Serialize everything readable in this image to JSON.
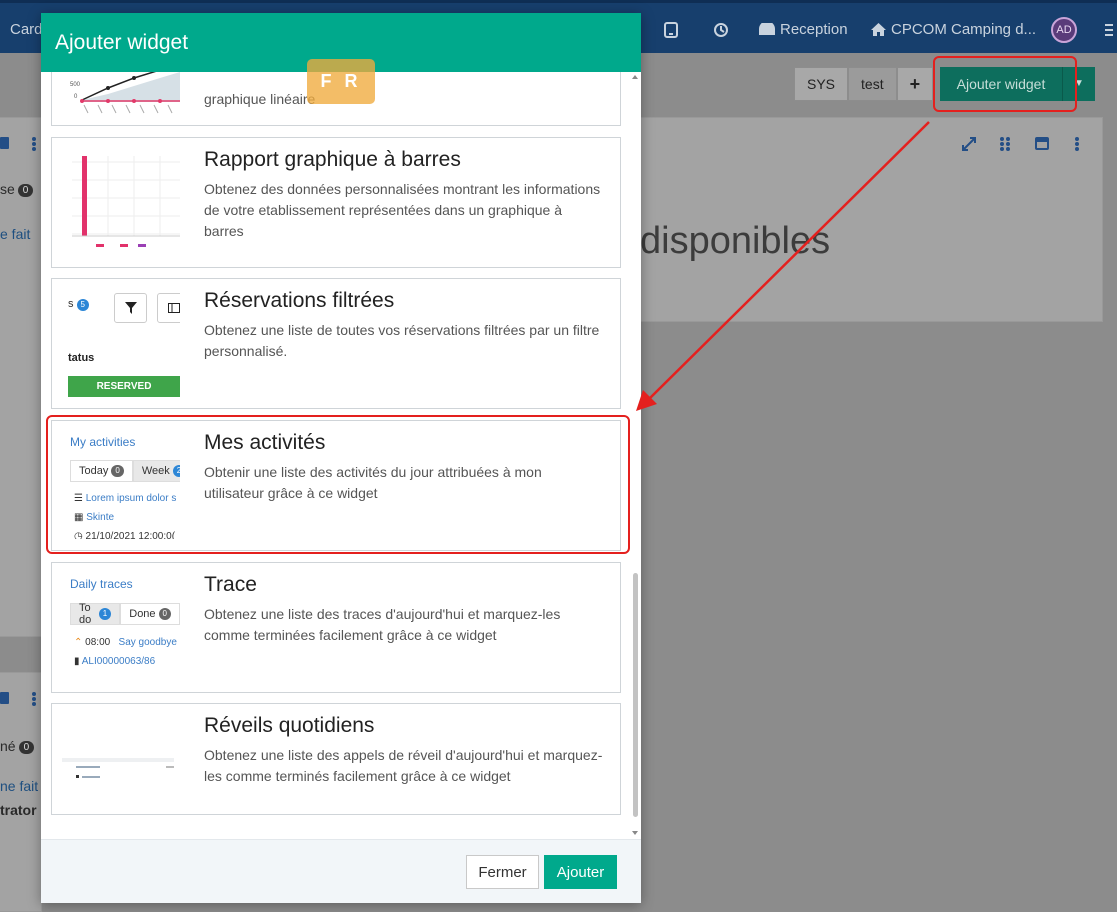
{
  "topbar": {
    "card_label": "Card",
    "reception_label": "Reception",
    "camping_label": "CPCOM Camping d...",
    "avatar_initials": "AD"
  },
  "background": {
    "seg_sys": "SYS",
    "seg_test": "test",
    "seg_plus": "+",
    "add_widget": "Ajouter widget",
    "big_text": "disponibles",
    "left_texts": [
      "se",
      "e fait",
      "né",
      "ne fait",
      "trator"
    ],
    "left_badges": [
      "0",
      "0"
    ]
  },
  "modal": {
    "title": "Ajouter widget",
    "lang_tag": "F R",
    "close_label": "Fermer",
    "add_label": "Ajouter"
  },
  "widgets": [
    {
      "title": "",
      "description": "graphique linéaire",
      "thumb": {
        "y_labels": [
          "500",
          "0"
        ]
      }
    },
    {
      "title": "Rapport graphique à barres",
      "description": "Obtenez des données personnalisées montrant les informations de votre etablissement représentées dans un graphique à barres"
    },
    {
      "title": "Réservations filtrées",
      "description": "Obtenez une liste de toutes vos réservations filtrées par un filtre personnalisé.",
      "thumb": {
        "count_prefix": "s",
        "count": "5",
        "column": "tatus",
        "status": "RESERVED"
      }
    },
    {
      "title": "Mes activités",
      "description": "Obtenir une liste des activités du jour attribuées à mon utilisateur grâce à ce widget",
      "thumb": {
        "heading": "My activities",
        "tab_today": "Today",
        "tab_today_count": "0",
        "tab_week": "Week",
        "tab_week_count": "2",
        "row1": "Lorem ipsum dolor s",
        "row2": "Skinte",
        "row3": "21/10/2021 12:00:0("
      }
    },
    {
      "title": "Trace",
      "description": "Obtenez une liste des traces d'aujourd'hui et marquez-les comme terminées facilement grâce à ce widget",
      "thumb": {
        "heading": "Daily traces",
        "tab_todo": "To do",
        "tab_todo_count": "1",
        "tab_done": "Done",
        "tab_done_count": "0",
        "row1_time": "08:00",
        "row1_text": "Say goodbye",
        "row2": "ALI00000063/86"
      }
    },
    {
      "title": "Réveils quotidiens",
      "description": "Obtenez une liste des appels de réveil d'aujourd'hui et marquez-les comme terminés facilement grâce à ce widget"
    }
  ],
  "colors": {
    "brand": "#00a98c",
    "topbar": "#173f6d",
    "annotation": "#e4201e",
    "link": "#3b7dc6"
  }
}
